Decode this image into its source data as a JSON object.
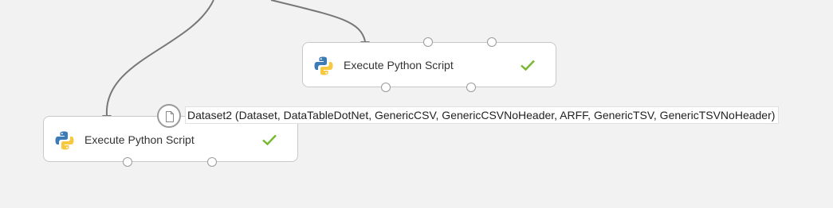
{
  "colors": {
    "canvas_background": "#f2f2f2",
    "module_border": "#c8c8c8",
    "connector": "#777777",
    "status_success": "#7ab733",
    "python_blue": "#3d7bb6",
    "python_yellow": "#f7c941"
  },
  "modules": [
    {
      "label": "Execute Python Script",
      "icon": "python-icon",
      "status": "completed",
      "status_icon": "checkmark-icon"
    },
    {
      "label": "Execute Python Script",
      "icon": "python-icon",
      "status": "completed",
      "status_icon": "checkmark-icon"
    }
  ],
  "port_tooltip": {
    "text": "Dataset2 (Dataset, DataTableDotNet, GenericCSV, GenericCSVNoHeader, ARFF, GenericTSV, GenericTSVNoHeader)",
    "icon": "file-icon"
  }
}
